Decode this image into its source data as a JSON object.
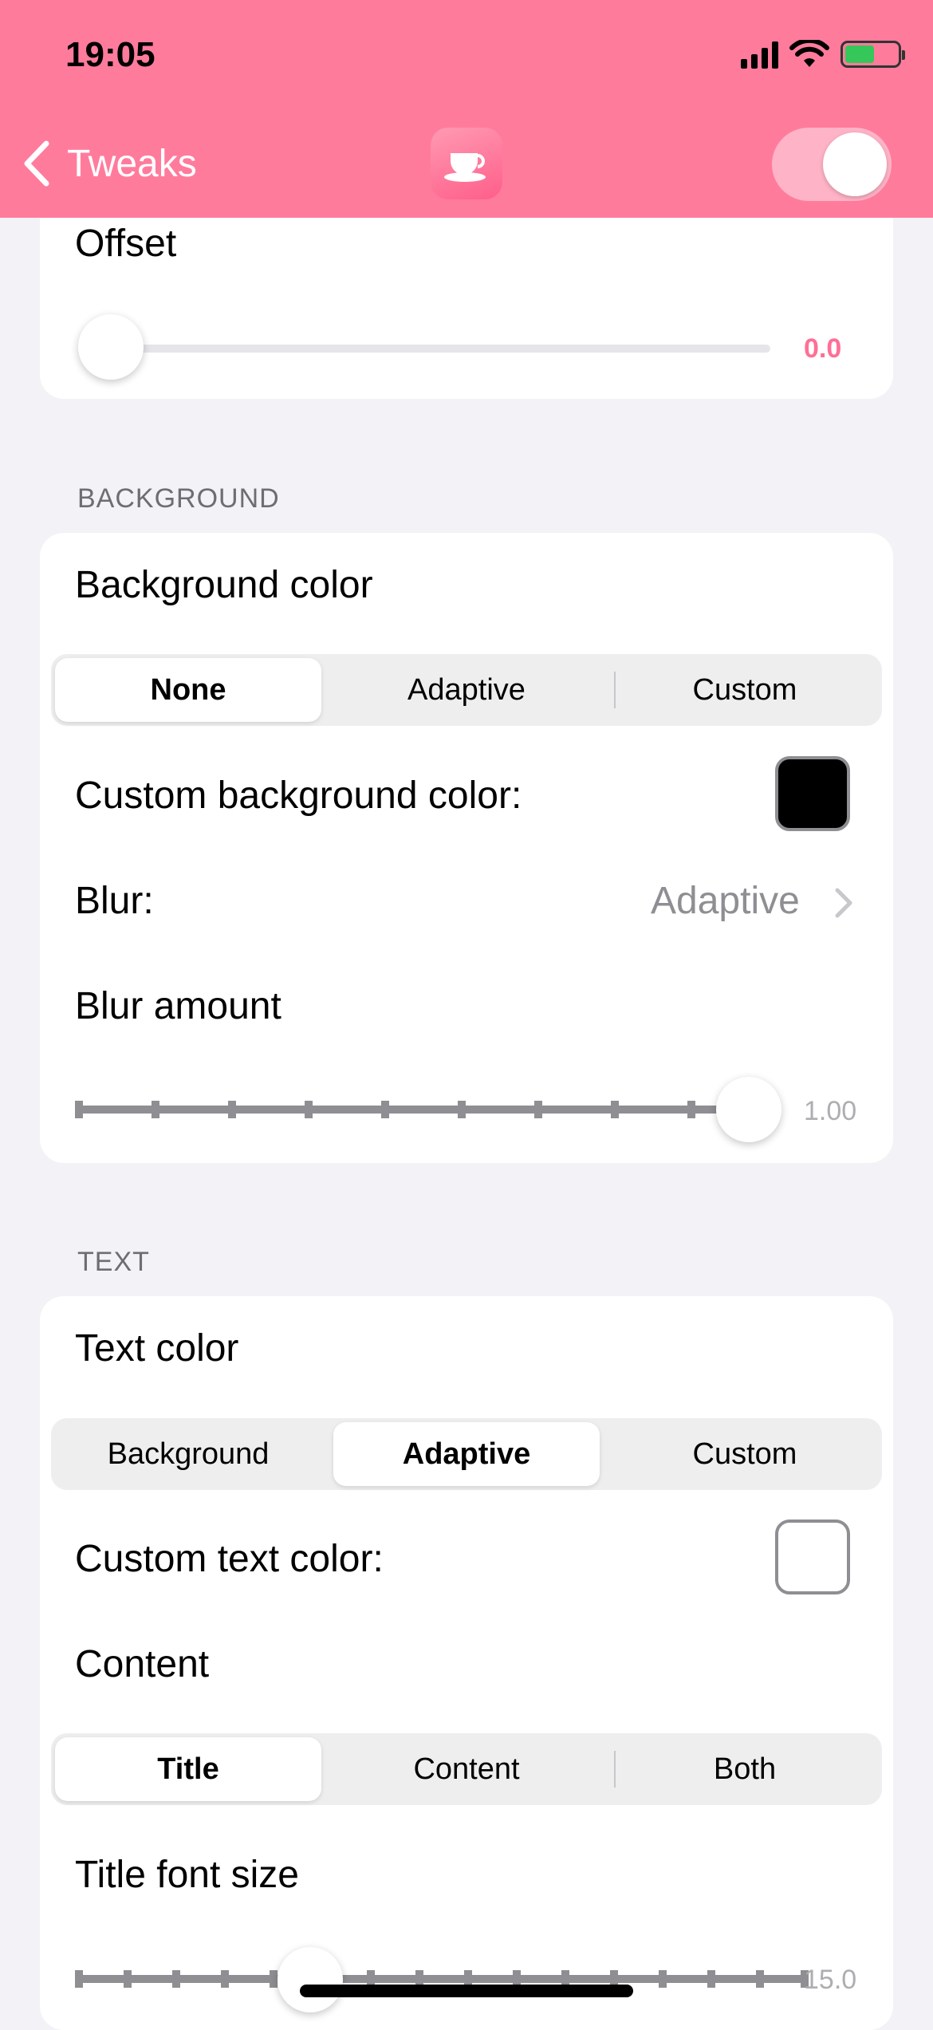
{
  "status_bar": {
    "time": "19:05"
  },
  "nav": {
    "back_label": "Tweaks",
    "toggle_on": true,
    "accent": "#ff7b9c"
  },
  "offset": {
    "label": "Offset",
    "value": "0.0",
    "value_color": "#ff6f95"
  },
  "background": {
    "section_title": "BACKGROUND",
    "color_label": "Background color",
    "segments": [
      "None",
      "Adaptive",
      "Custom"
    ],
    "selected": "None",
    "custom_color_label": "Custom background color:",
    "custom_color": "#000000",
    "blur_label": "Blur:",
    "blur_value": "Adaptive",
    "blur_amount_label": "Blur amount",
    "blur_amount_value": "1.00"
  },
  "text": {
    "section_title": "TEXT",
    "color_label": "Text color",
    "color_segments": [
      "Background",
      "Adaptive",
      "Custom"
    ],
    "color_selected": "Adaptive",
    "custom_color_label": "Custom text color:",
    "custom_color": "#ffffff",
    "content_label": "Content",
    "content_segments": [
      "Title",
      "Content",
      "Both"
    ],
    "content_selected": "Title",
    "title_font_size_label": "Title font size",
    "title_font_size_value": "15.0"
  }
}
